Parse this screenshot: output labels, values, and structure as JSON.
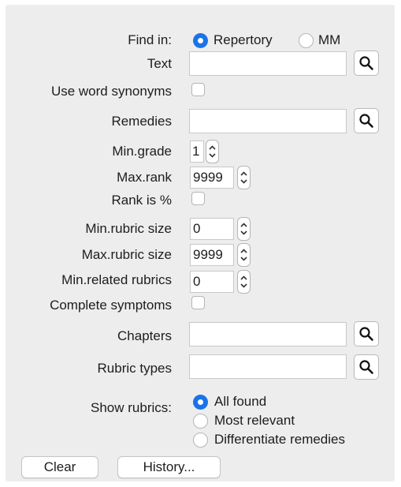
{
  "labels": {
    "find_in": "Find in:",
    "text": "Text",
    "use_word_synonyms": "Use word synonyms",
    "remedies": "Remedies",
    "min_grade": "Min.grade",
    "max_rank": "Max.rank",
    "rank_is_percent": "Rank is %",
    "min_rubric_size": "Min.rubric size",
    "max_rubric_size": "Max.rubric size",
    "min_related_rubrics": "Min.related rubrics",
    "complete_symptoms": "Complete symptoms",
    "chapters": "Chapters",
    "rubric_types": "Rubric types",
    "show_rubrics": "Show rubrics:"
  },
  "find_in_options": {
    "repertory": "Repertory",
    "mm": "MM",
    "selected": "Repertory"
  },
  "values": {
    "text": "",
    "remedies": "",
    "min_grade": "1",
    "max_rank": "9999",
    "min_rubric_size": "0",
    "max_rubric_size": "9999",
    "min_related_rubrics": "0",
    "chapters": "",
    "rubric_types": ""
  },
  "checkboxes": {
    "use_word_synonyms": false,
    "rank_is_percent": false,
    "complete_symptoms": false
  },
  "show_rubrics_options": {
    "all_found": "All found",
    "most_relevant": "Most relevant",
    "differentiate_remedies": "Differentiate remedies",
    "selected": "All found"
  },
  "buttons": {
    "clear": "Clear",
    "history": "History..."
  },
  "icons": {
    "search": "search-icon",
    "stepper": "stepper-arrows-icon"
  },
  "colors": {
    "accent": "#1a73e8",
    "panel": "#ededed"
  }
}
